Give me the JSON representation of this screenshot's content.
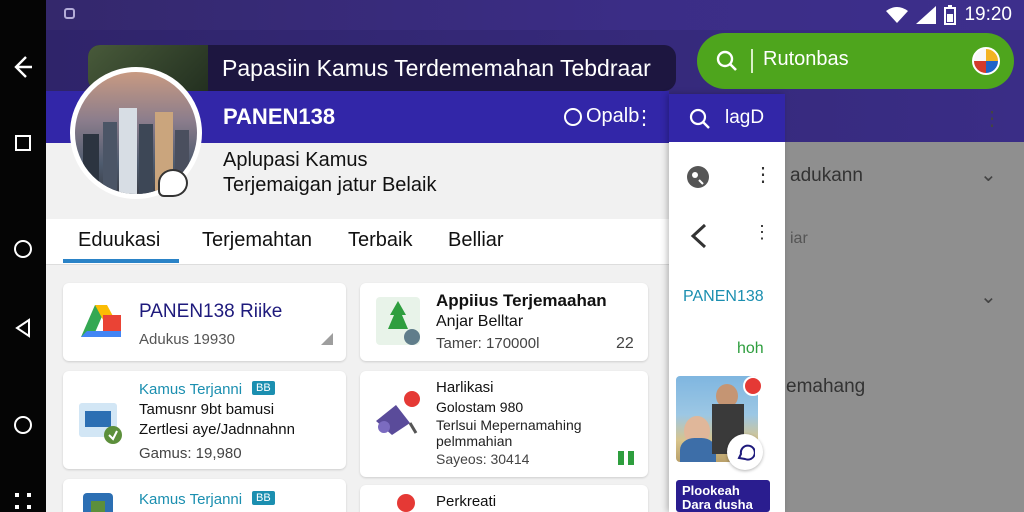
{
  "status": {
    "time": "19:20"
  },
  "title_bar": {
    "text": "Papasiin Kamus Terdememahan Tebdraar"
  },
  "search": {
    "text": "Rutonbas"
  },
  "header": {
    "brand": "PANEN138",
    "action": "Opalb",
    "more": "⋮"
  },
  "app": {
    "subtitle1": "Aplupasi Kamus",
    "subtitle2": "Terjemaigan jatur Belaik"
  },
  "tabs": [
    {
      "label": "Eduukasi"
    },
    {
      "label": "Terjemahtan"
    },
    {
      "label": "Terbaik"
    },
    {
      "label": "Belliar"
    }
  ],
  "cards": [
    {
      "title": "PANEN138 Riike",
      "meta": "Adukus 19930"
    },
    {
      "title": "Appiius Terjemaahan",
      "title2": "Anjar Belltar",
      "meta": "Tamer: 170000l",
      "count": "22"
    },
    {
      "title": "Kamus Terjanni",
      "badge": "BB",
      "line1": "Tamusnr 9bt bamusi",
      "line2": "Zertlesi aye/Jadnnahnn",
      "meta": "Gamus: 19,980"
    },
    {
      "title": "Harlikasi",
      "title2": "Golostam 980",
      "line1": "Terlsui Mepernamahing",
      "line2": "pelmmahian",
      "meta": "Sayeos: 30414"
    },
    {
      "title": "Kamus Terjanni",
      "badge": "BB"
    },
    {
      "title": "Perkreati"
    }
  ],
  "panel": {
    "search_label": "lagD",
    "brand": "PANEN138",
    "link": "hoh",
    "banner_line1": "Plookeah",
    "banner_line2": "Dara dusha"
  },
  "bg": {
    "row1": "adukann",
    "row2": "iar",
    "row3": "emahang"
  },
  "colors": {
    "header_blue": "#3226a8",
    "search_green": "#4ea51d",
    "tab_underline": "#2a83c7",
    "brand_teal": "#1b8fb0",
    "link_green": "#2e9e3e"
  }
}
